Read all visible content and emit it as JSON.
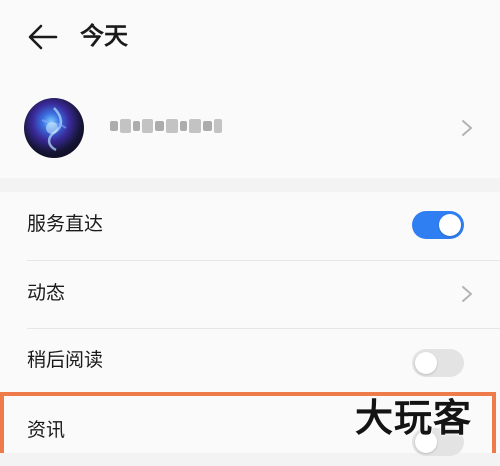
{
  "header": {
    "title": "今天"
  },
  "settings": [
    {
      "label": "服务直达",
      "control": "switch",
      "on": true
    },
    {
      "label": "动态",
      "control": "chevron"
    },
    {
      "label": "稍后阅读",
      "control": "switch",
      "on": false
    },
    {
      "label": "资讯",
      "control": "switch",
      "on": false
    }
  ],
  "watermark": "大玩客",
  "colors": {
    "accent": "#2f7ff2",
    "highlight": "#ee7b49",
    "switch_off": "#e3e3e3"
  },
  "icons": {
    "back": "back-arrow-icon",
    "chevron": "chevron-right-icon"
  }
}
